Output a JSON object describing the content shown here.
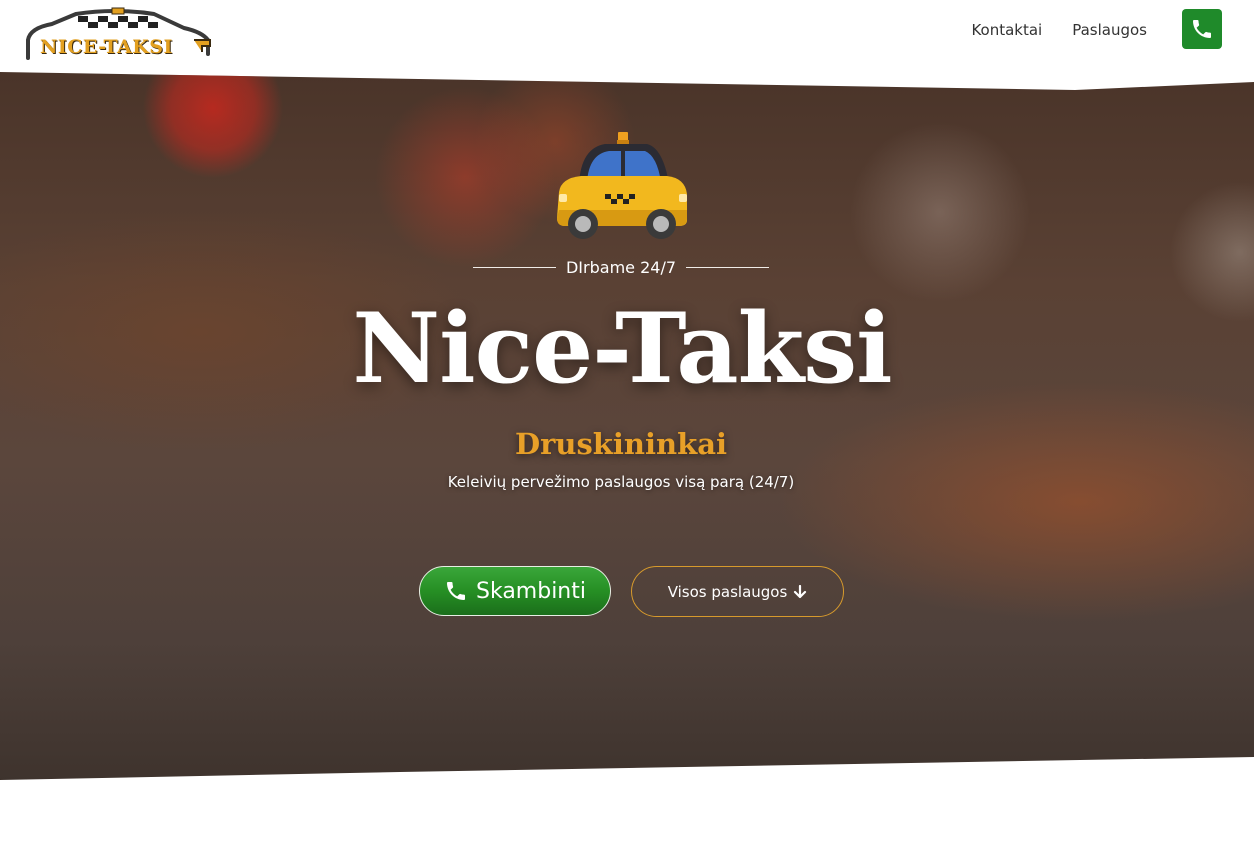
{
  "header": {
    "logo_text": "NICE-TAKSI",
    "nav": [
      {
        "label": "Kontaktai"
      },
      {
        "label": "Paslaugos"
      }
    ],
    "phone_icon": "phone-icon"
  },
  "hero": {
    "illustration": "taxi-icon",
    "tagline": "DIrbame 24/7",
    "title": "Nice-Taksi",
    "city": "Druskininkai",
    "subtitle": "Keleivių pervežimo paslaugos visą parą (24/7)",
    "call_button": {
      "label": "Skambinti",
      "icon": "phone-icon"
    },
    "services_button": {
      "label": "Visos paslaugos",
      "icon": "arrow-down-icon"
    }
  },
  "colors": {
    "accent": "#e8a028",
    "call_green": "#268f24",
    "phone_button": "#1f8a2a",
    "nav_text": "#333333"
  }
}
